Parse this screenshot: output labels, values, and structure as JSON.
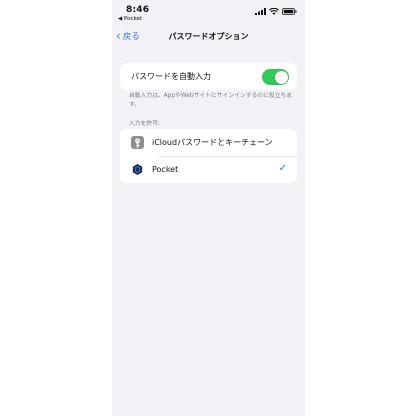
{
  "status_bar": {
    "time": "8:46",
    "back_app": "◀ Pocket"
  },
  "nav": {
    "back_label": "戻る",
    "title": "パスワードオプション"
  },
  "autofill": {
    "label": "パスワードを自動入力",
    "enabled": true,
    "footnote": "自動入力は、AppやWebサイトにサインインするのに役立ちます。"
  },
  "allow_section": {
    "header": "入力を許可:",
    "items": [
      {
        "label": "iCloudパスワードとキーチェーン",
        "icon": "key-icon",
        "checked": false
      },
      {
        "label": "Pocket",
        "icon": "pocket-app-icon",
        "checked": true
      }
    ]
  },
  "colors": {
    "accent": "#3478f6",
    "toggle_on": "#34c759",
    "background": "#f1f1f6"
  }
}
